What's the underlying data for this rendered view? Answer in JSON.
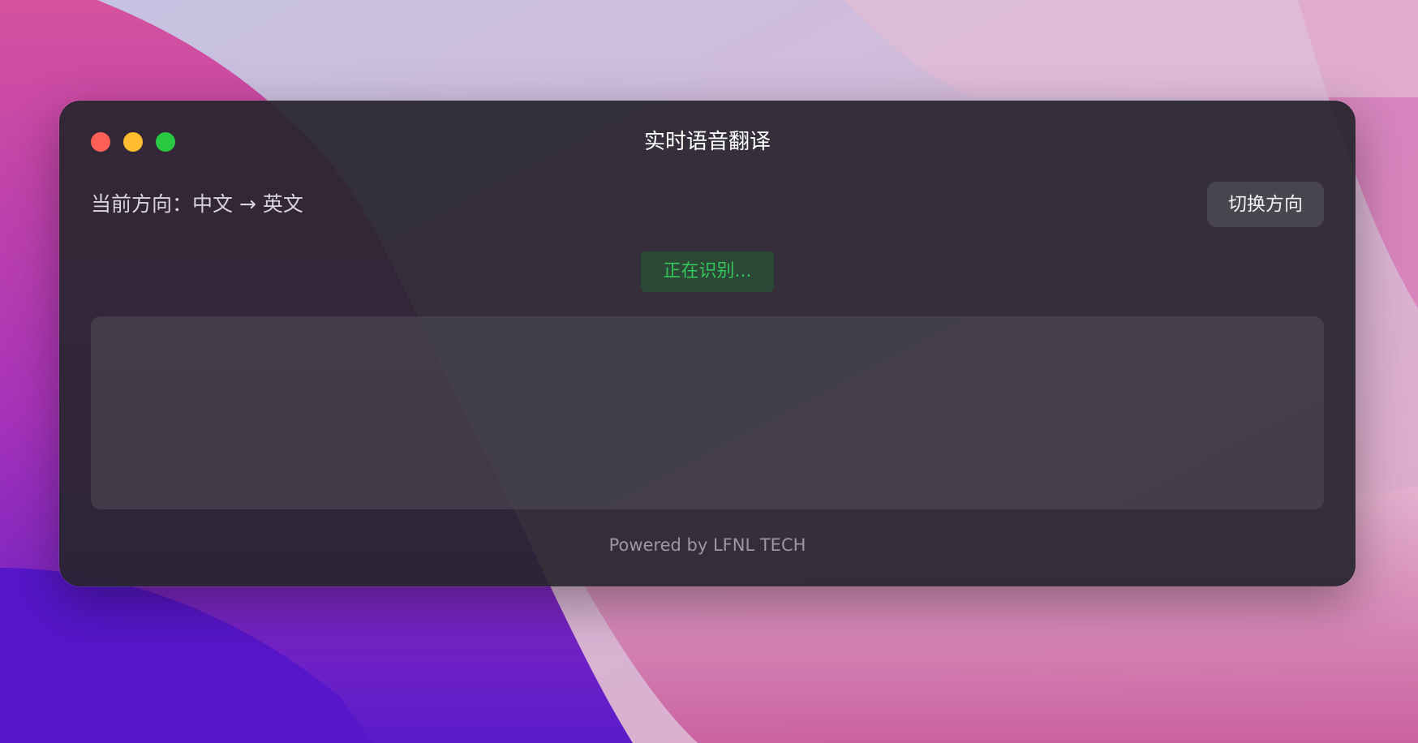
{
  "window": {
    "title": "实时语音翻译",
    "traffic_lights": {
      "close_color": "#fe5f57",
      "minimize_color": "#febc2e",
      "zoom_color": "#28c840"
    }
  },
  "direction": {
    "label": "当前方向：中文 → 英文"
  },
  "toolbar": {
    "switch_label": "切换方向"
  },
  "status": {
    "text": "正在识别...",
    "color": "#35c55a"
  },
  "result": {
    "text": ""
  },
  "footer": {
    "text": "Powered by LFNL TECH"
  },
  "colors": {
    "window_bg": "#28252e",
    "accent_green": "#35c55a"
  }
}
